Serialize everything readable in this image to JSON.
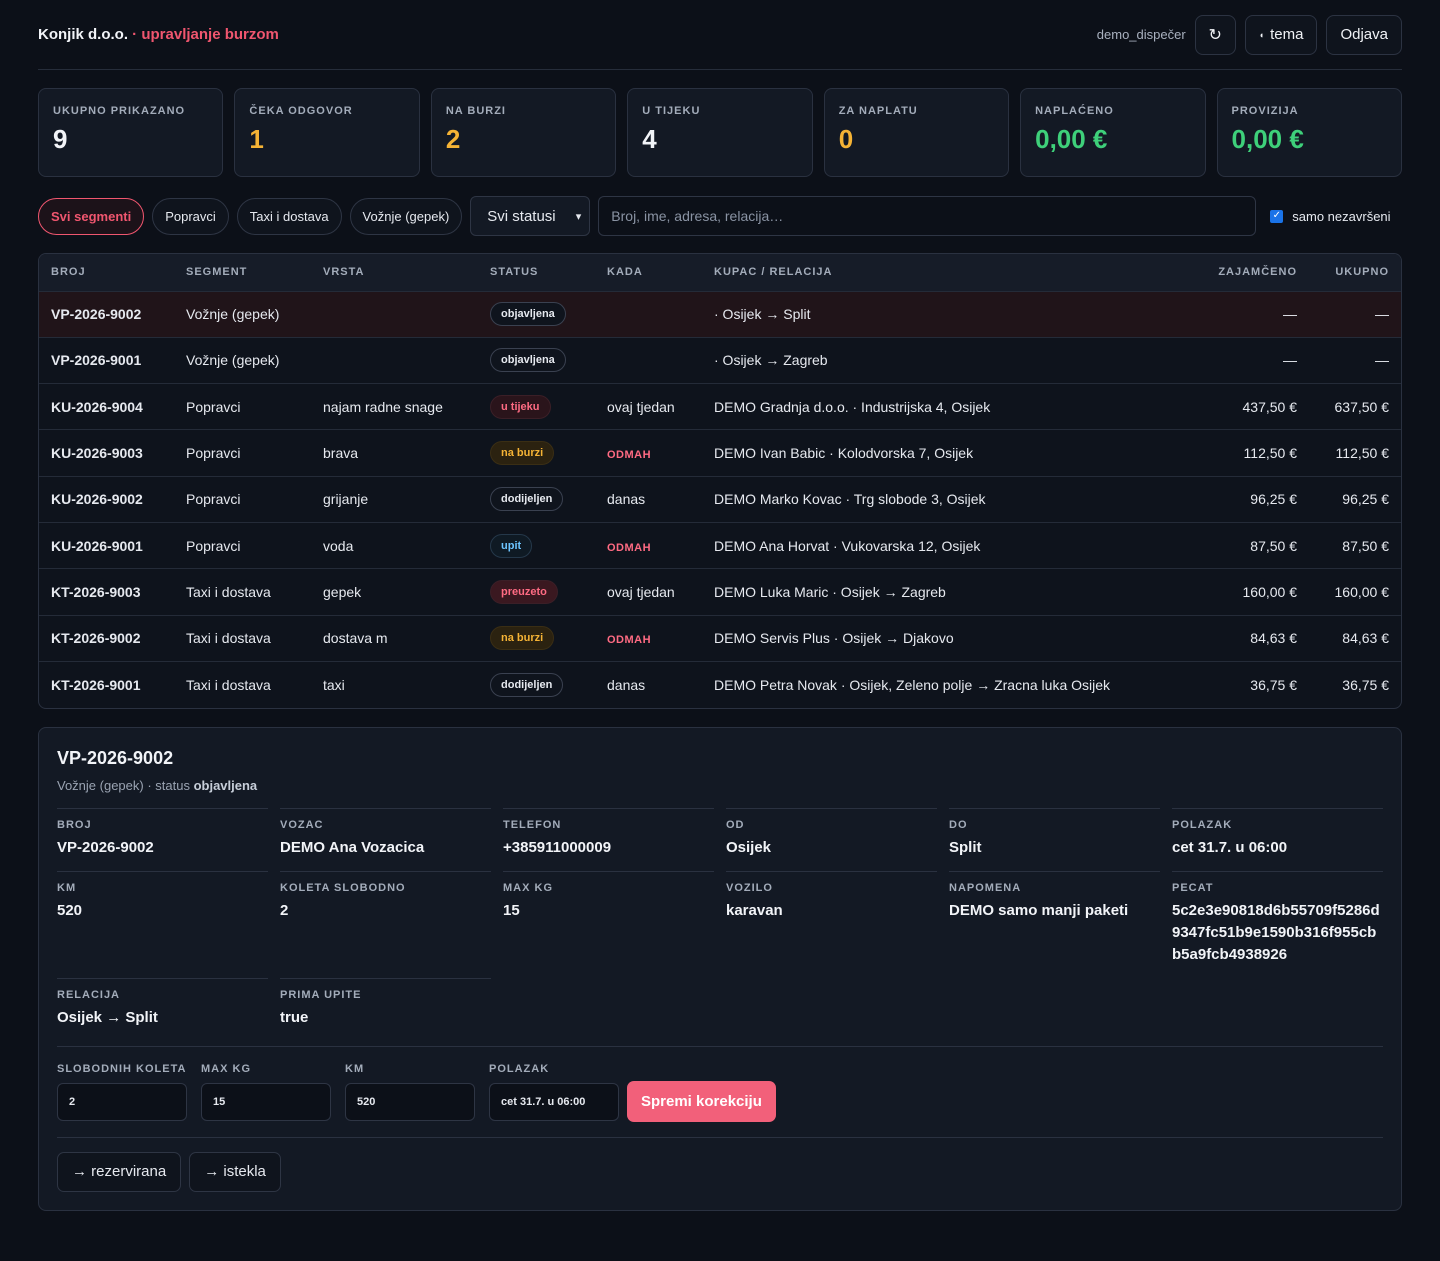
{
  "header": {
    "brand_name": "Konjik d.o.o.",
    "brand_dot": " · ",
    "brand_sub": "upravljanje burzom",
    "user": "demo_dispečer",
    "refresh_icon": "↻",
    "theme_icon": "◖",
    "theme_label": "tema",
    "logout_label": "Odjava"
  },
  "stats": [
    {
      "label": "UKUPNO PRIKAZANO",
      "value": "9",
      "color": "#f2f4f8"
    },
    {
      "label": "ČEKA ODGOVOR",
      "value": "1",
      "color": "#f5b335"
    },
    {
      "label": "NA BURZI",
      "value": "2",
      "color": "#f5b335"
    },
    {
      "label": "U TIJEKU",
      "value": "4",
      "color": "#f2f4f8"
    },
    {
      "label": "ZA NAPLATU",
      "value": "0",
      "color": "#f5b335"
    },
    {
      "label": "NAPLAĆENO",
      "value": "0,00 €",
      "color": "#3ed07a"
    },
    {
      "label": "PROVIZIJA",
      "value": "0,00 €",
      "color": "#3ed07a"
    }
  ],
  "filters": {
    "segments": [
      "Svi segmenti",
      "Popravci",
      "Taxi i dostava",
      "Vožnje (gepek)"
    ],
    "status_select": "Svi statusi",
    "search_placeholder": "Broj, ime, adresa, relacija…",
    "only_open_label": "samo nezavršeni",
    "only_open_checked": true
  },
  "table": {
    "headers": [
      "BROJ",
      "SEGMENT",
      "VRSTA",
      "STATUS",
      "KADA",
      "KUPAC / RELACIJA",
      "ZAJAMČENO",
      "UKUPNO"
    ],
    "rows": [
      {
        "broj": "VP-2026-9002",
        "segment": "Vožnje (gepek)",
        "vrsta": "",
        "status": "objavljena",
        "status_type": "plain",
        "kada": "",
        "kada_urgent": false,
        "kupac": "· Osijek → Split",
        "zajamceno": "—",
        "ukupno": "—"
      },
      {
        "broj": "VP-2026-9001",
        "segment": "Vožnje (gepek)",
        "vrsta": "",
        "status": "objavljena",
        "status_type": "plain",
        "kada": "",
        "kada_urgent": false,
        "kupac": "· Osijek → Zagreb",
        "zajamceno": "—",
        "ukupno": "—"
      },
      {
        "broj": "KU-2026-9004",
        "segment": "Popravci",
        "vrsta": "najam radne snage",
        "status": "u tijeku",
        "status_type": "tijek",
        "kada": "ovaj tjedan",
        "kada_urgent": false,
        "kupac": "DEMO Gradnja d.o.o. · Industrijska 4, Osijek",
        "zajamceno": "437,50 €",
        "ukupno": "637,50 €"
      },
      {
        "broj": "KU-2026-9003",
        "segment": "Popravci",
        "vrsta": "brava",
        "status": "na burzi",
        "status_type": "burzi",
        "kada": "ODMAH",
        "kada_urgent": true,
        "kupac": "DEMO Ivan Babic · Kolodvorska 7, Osijek",
        "zajamceno": "112,50 €",
        "ukupno": "112,50 €"
      },
      {
        "broj": "KU-2026-9002",
        "segment": "Popravci",
        "vrsta": "grijanje",
        "status": "dodijeljen",
        "status_type": "plain",
        "kada": "danas",
        "kada_urgent": false,
        "kupac": "DEMO Marko Kovac · Trg slobode 3, Osijek",
        "zajamceno": "96,25 €",
        "ukupno": "96,25 €"
      },
      {
        "broj": "KU-2026-9001",
        "segment": "Popravci",
        "vrsta": "voda",
        "status": "upit",
        "status_type": "upit",
        "kada": "ODMAH",
        "kada_urgent": true,
        "kupac": "DEMO Ana Horvat · Vukovarska 12, Osijek",
        "zajamceno": "87,50 €",
        "ukupno": "87,50 €"
      },
      {
        "broj": "KT-2026-9003",
        "segment": "Taxi i dostava",
        "vrsta": "gepek",
        "status": "preuzeto",
        "status_type": "preuz",
        "kada": "ovaj tjedan",
        "kada_urgent": false,
        "kupac": "DEMO Luka Maric · Osijek → Zagreb",
        "zajamceno": "160,00 €",
        "ukupno": "160,00 €"
      },
      {
        "broj": "KT-2026-9002",
        "segment": "Taxi i dostava",
        "vrsta": "dostava m",
        "status": "na burzi",
        "status_type": "burzi",
        "kada": "ODMAH",
        "kada_urgent": true,
        "kupac": "DEMO Servis Plus · Osijek → Djakovo",
        "zajamceno": "84,63 €",
        "ukupno": "84,63 €"
      },
      {
        "broj": "KT-2026-9001",
        "segment": "Taxi i dostava",
        "vrsta": "taxi",
        "status": "dodijeljen",
        "status_type": "plain",
        "kada": "danas",
        "kada_urgent": false,
        "kupac": "DEMO Petra Novak · Osijek, Zeleno polje → Zracna luka Osijek",
        "zajamceno": "36,75 €",
        "ukupno": "36,75 €"
      }
    ]
  },
  "detail": {
    "title": "VP-2026-9002",
    "subtitle_prefix": "Vožnje (gepek) · status ",
    "subtitle_status": "objavljena",
    "fields": [
      {
        "k": "BROJ",
        "v": "VP-2026-9002"
      },
      {
        "k": "VOZAC",
        "v": "DEMO Ana Vozacica"
      },
      {
        "k": "TELEFON",
        "v": "+385911000009"
      },
      {
        "k": "OD",
        "v": "Osijek"
      },
      {
        "k": "DO",
        "v": "Split"
      },
      {
        "k": "POLAZAK",
        "v": "cet 31.7. u 06:00"
      },
      {
        "k": "KM",
        "v": "520"
      },
      {
        "k": "KOLETA SLOBODNO",
        "v": "2"
      },
      {
        "k": "MAX KG",
        "v": "15"
      },
      {
        "k": "VOZILO",
        "v": "karavan"
      },
      {
        "k": "NAPOMENA",
        "v": "DEMO samo manji paketi"
      },
      {
        "k": "PECAT",
        "v": "5c2e3e90818d6b55709f5286d9347fc51b9e1590b316f955cbb5a9fcb4938926"
      },
      {
        "k": "RELACIJA",
        "v": "Osijek → Split"
      },
      {
        "k": "PRIMA UPITE",
        "v": "true"
      }
    ],
    "form": [
      {
        "k": "SLOBODNIH KOLETA",
        "v": "2"
      },
      {
        "k": "MAX KG",
        "v": "15"
      },
      {
        "k": "KM",
        "v": "520"
      },
      {
        "k": "POLAZAK",
        "v": "cet 31.7. u 06:00"
      }
    ],
    "save_label": "Spremi korekciju",
    "actions": [
      "→ rezervirana",
      "→ istekla"
    ]
  }
}
